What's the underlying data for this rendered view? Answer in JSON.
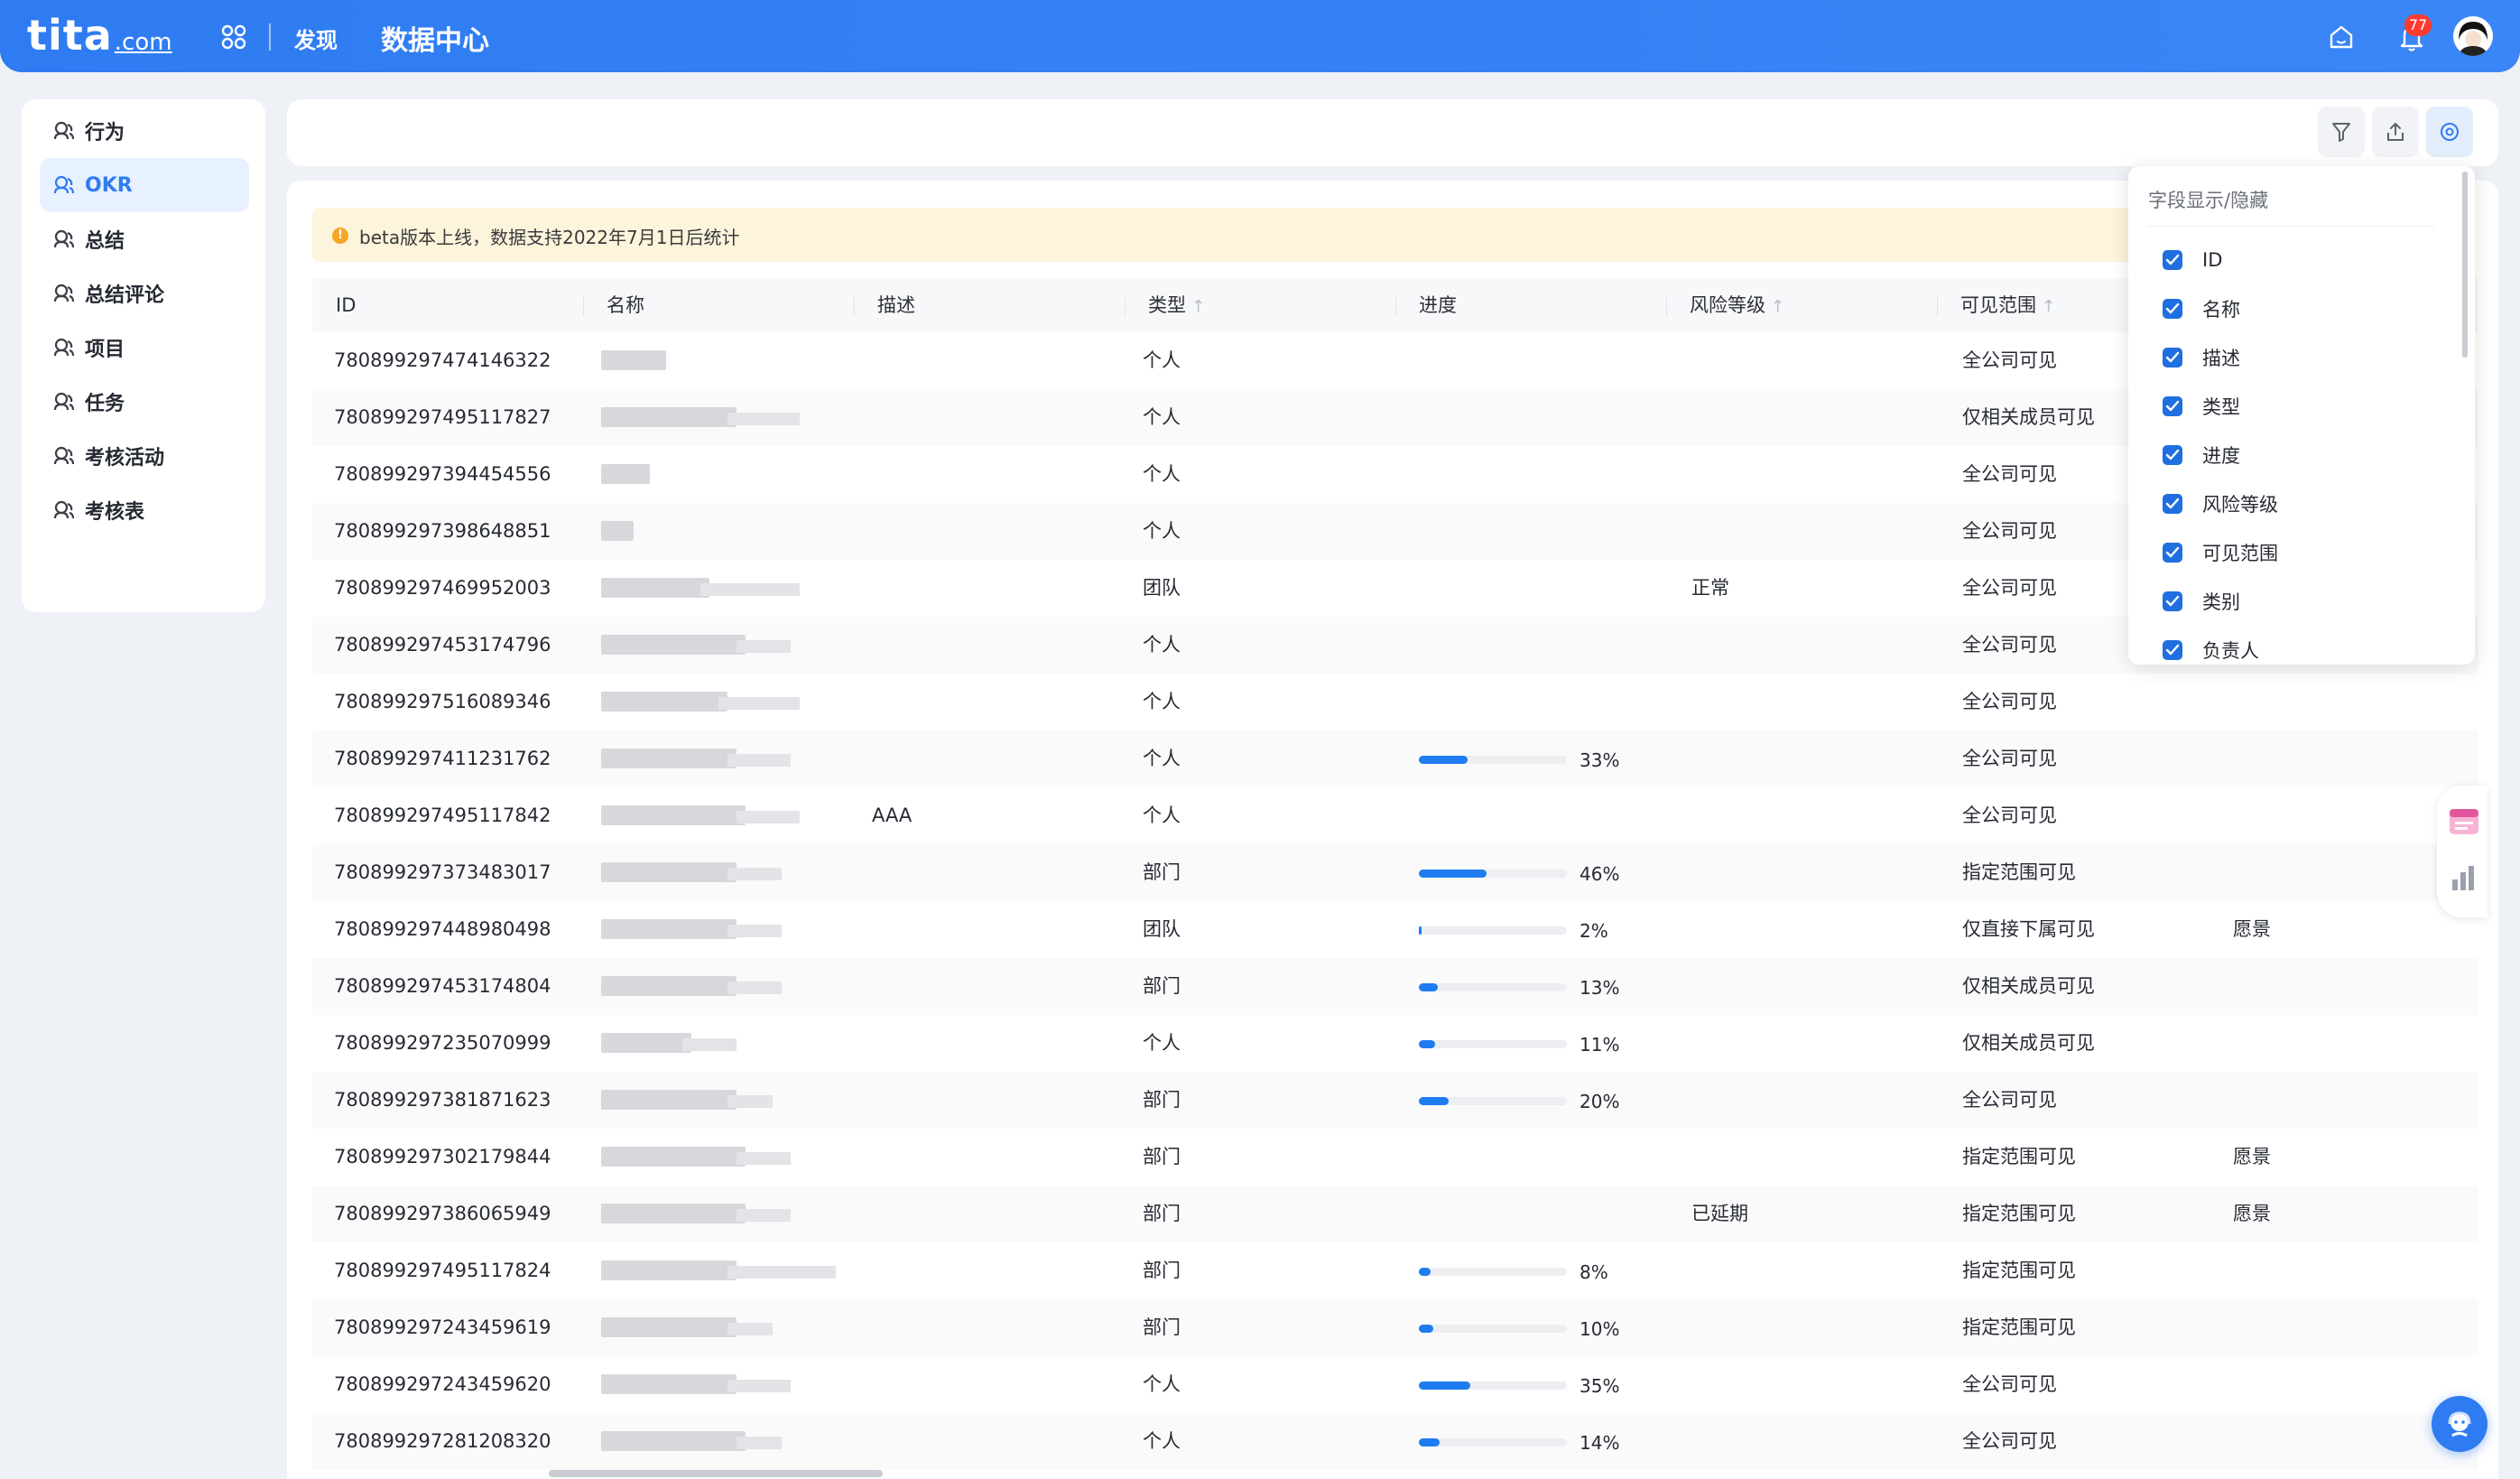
{
  "header": {
    "logo_main": "tita",
    "logo_sub": ".com",
    "nav_discover": "发现",
    "nav_title": "数据中心",
    "notification_count": "77"
  },
  "sidebar": {
    "items": [
      {
        "label": "行为",
        "active": false
      },
      {
        "label": "OKR",
        "active": true
      },
      {
        "label": "总结",
        "active": false
      },
      {
        "label": "总结评论",
        "active": false
      },
      {
        "label": "项目",
        "active": false
      },
      {
        "label": "任务",
        "active": false
      },
      {
        "label": "考核活动",
        "active": false
      },
      {
        "label": "考核表",
        "active": false
      }
    ]
  },
  "notice": "beta版本上线，数据支持2022年7月1日后统计",
  "table": {
    "columns": [
      {
        "label": "ID",
        "sortable": false
      },
      {
        "label": "名称",
        "sortable": false
      },
      {
        "label": "描述",
        "sortable": false
      },
      {
        "label": "类型",
        "sortable": true
      },
      {
        "label": "进度",
        "sortable": false
      },
      {
        "label": "风险等级",
        "sortable": true
      },
      {
        "label": "可见范围",
        "sortable": true
      }
    ],
    "rows": [
      {
        "id": "780899297474146322",
        "desc": "",
        "type": "个人",
        "progress": null,
        "risk": "",
        "scope": "全公司可见",
        "category": ""
      },
      {
        "id": "780899297495117827",
        "desc": "",
        "type": "个人",
        "progress": null,
        "risk": "",
        "scope": "仅相关成员可见",
        "category": ""
      },
      {
        "id": "780899297394454556",
        "desc": "",
        "type": "个人",
        "progress": null,
        "risk": "",
        "scope": "全公司可见",
        "category": ""
      },
      {
        "id": "780899297398648851",
        "desc": "",
        "type": "个人",
        "progress": null,
        "risk": "",
        "scope": "全公司可见",
        "category": ""
      },
      {
        "id": "780899297469952003",
        "desc": "",
        "type": "团队",
        "progress": null,
        "risk": "正常",
        "scope": "全公司可见",
        "category": ""
      },
      {
        "id": "780899297453174796",
        "desc": "",
        "type": "个人",
        "progress": null,
        "risk": "",
        "scope": "全公司可见",
        "category": ""
      },
      {
        "id": "780899297516089346",
        "desc": "",
        "type": "个人",
        "progress": null,
        "risk": "",
        "scope": "全公司可见",
        "category": ""
      },
      {
        "id": "780899297411231762",
        "desc": "",
        "type": "个人",
        "progress": 33,
        "risk": "",
        "scope": "全公司可见",
        "category": ""
      },
      {
        "id": "780899297495117842",
        "desc": "AAA",
        "type": "个人",
        "progress": null,
        "risk": "",
        "scope": "全公司可见",
        "category": ""
      },
      {
        "id": "780899297373483017",
        "desc": "",
        "type": "部门",
        "progress": 46,
        "risk": "",
        "scope": "指定范围可见",
        "category": ""
      },
      {
        "id": "780899297448980498",
        "desc": "",
        "type": "团队",
        "progress": 2,
        "risk": "",
        "scope": "仅直接下属可见",
        "category": "愿景"
      },
      {
        "id": "780899297453174804",
        "desc": "",
        "type": "部门",
        "progress": 13,
        "risk": "",
        "scope": "仅相关成员可见",
        "category": ""
      },
      {
        "id": "780899297235070999",
        "desc": "",
        "type": "个人",
        "progress": 11,
        "risk": "",
        "scope": "仅相关成员可见",
        "category": ""
      },
      {
        "id": "780899297381871623",
        "desc": "",
        "type": "部门",
        "progress": 20,
        "risk": "",
        "scope": "全公司可见",
        "category": ""
      },
      {
        "id": "780899297302179844",
        "desc": "",
        "type": "部门",
        "progress": null,
        "risk": "",
        "scope": "指定范围可见",
        "category": "愿景"
      },
      {
        "id": "780899297386065949",
        "desc": "",
        "type": "部门",
        "progress": null,
        "risk": "已延期",
        "scope": "指定范围可见",
        "category": "愿景"
      },
      {
        "id": "780899297495117824",
        "desc": "",
        "type": "部门",
        "progress": 8,
        "risk": "",
        "scope": "指定范围可见",
        "category": ""
      },
      {
        "id": "780899297243459619",
        "desc": "",
        "type": "部门",
        "progress": 10,
        "risk": "",
        "scope": "指定范围可见",
        "category": ""
      },
      {
        "id": "780899297243459620",
        "desc": "",
        "type": "个人",
        "progress": 35,
        "risk": "",
        "scope": "全公司可见",
        "category": ""
      },
      {
        "id": "780899297281208320",
        "desc": "",
        "type": "个人",
        "progress": 14,
        "risk": "",
        "scope": "全公司可见",
        "category": ""
      }
    ]
  },
  "field_popover": {
    "title": "字段显示/隐藏",
    "fields": [
      {
        "label": "ID",
        "checked": true
      },
      {
        "label": "名称",
        "checked": true
      },
      {
        "label": "描述",
        "checked": true
      },
      {
        "label": "类型",
        "checked": true
      },
      {
        "label": "进度",
        "checked": true
      },
      {
        "label": "风险等级",
        "checked": true
      },
      {
        "label": "可见范围",
        "checked": true
      },
      {
        "label": "类别",
        "checked": true
      },
      {
        "label": "负责人",
        "checked": true
      }
    ]
  },
  "colors": {
    "brand": "#2f7cf2",
    "progress": "#1f7cf0",
    "notice_bg": "#fdf4dc",
    "badge": "#ff3b30"
  }
}
